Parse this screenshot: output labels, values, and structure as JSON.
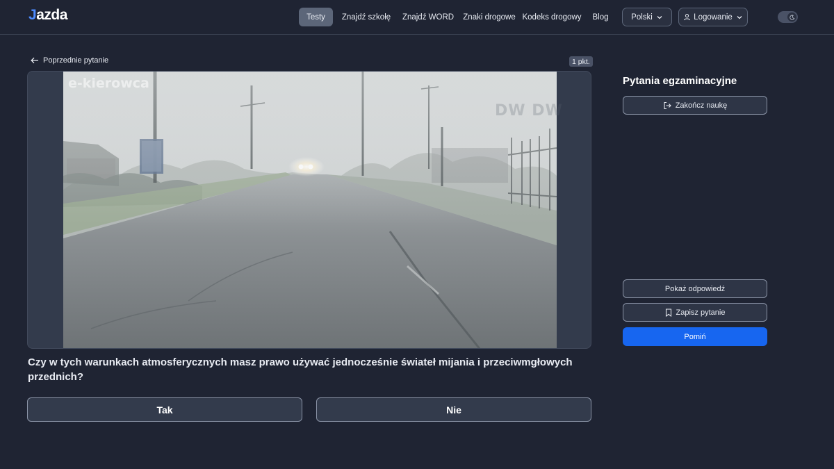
{
  "header": {
    "logo_mark": "J",
    "logo_text": "azda",
    "nav": [
      {
        "label": "Testy",
        "active": true
      },
      {
        "label": "Znajdź szkołę"
      },
      {
        "label": "Znajdź WORD"
      },
      {
        "label": "Znaki drogowe"
      },
      {
        "label": "Kodeks drogowy"
      },
      {
        "label": "Blog"
      }
    ],
    "language": "Polski",
    "login": "Logowanie",
    "theme_toggle_icon": "moon-icon"
  },
  "question_view": {
    "back_label": "Poprzednie pytanie",
    "points": "1 pkt.",
    "image_watermark": "e-kierowca",
    "image_watermark_2": "DW DW",
    "question": "Czy w tych warunkach atmosferycznych masz prawo używać jednocześnie świateł mijania i przeciwmgłowych przednich?",
    "answers": [
      "Tak",
      "Nie"
    ]
  },
  "side": {
    "title": "Pytania egzaminacyjne",
    "end_label": "Zakończ naukę",
    "show_answer_label": "Pokaż odpowiedź",
    "save_label": "Zapisz pytanie",
    "skip_label": "Pomiń"
  },
  "colors": {
    "background": "#1f2433",
    "primary": "#1766f0",
    "logo_accent": "#4d8bff"
  }
}
